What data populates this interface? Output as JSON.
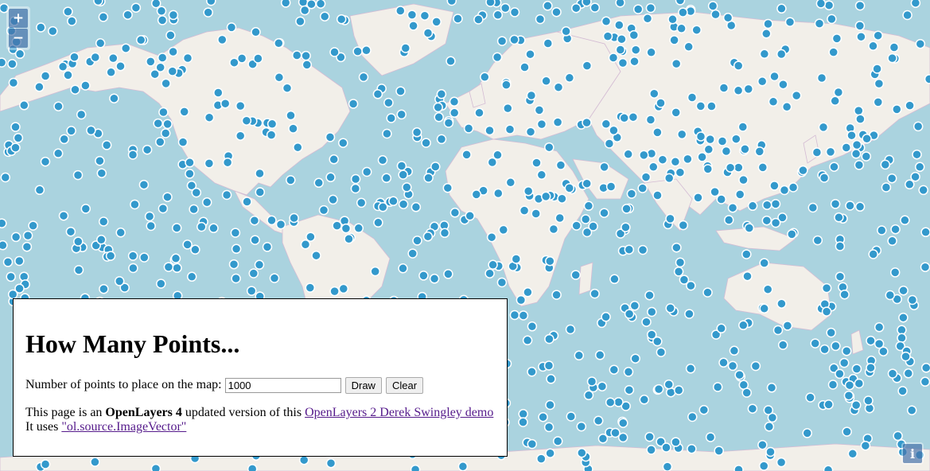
{
  "map": {
    "point_count": 1000,
    "point_color": "#3399cc",
    "ocean_color": "#aad3df",
    "land_color": "#f2efe9"
  },
  "controls": {
    "zoom_in_label": "+",
    "zoom_out_label": "−",
    "attribution_label": "i"
  },
  "panel": {
    "title": "How Many Points...",
    "points_label": "Number of points to place on the map:",
    "points_value": "1000",
    "draw_label": "Draw",
    "clear_label": "Clear",
    "info_prefix": "This page is an ",
    "info_bold": "OpenLayers 4",
    "info_middle": " updated version of this ",
    "demo_link_text": "OpenLayers 2 Derek Swingley demo",
    "uses_prefix": "It uses ",
    "source_link_text": "\"ol.source.ImageVector\""
  }
}
